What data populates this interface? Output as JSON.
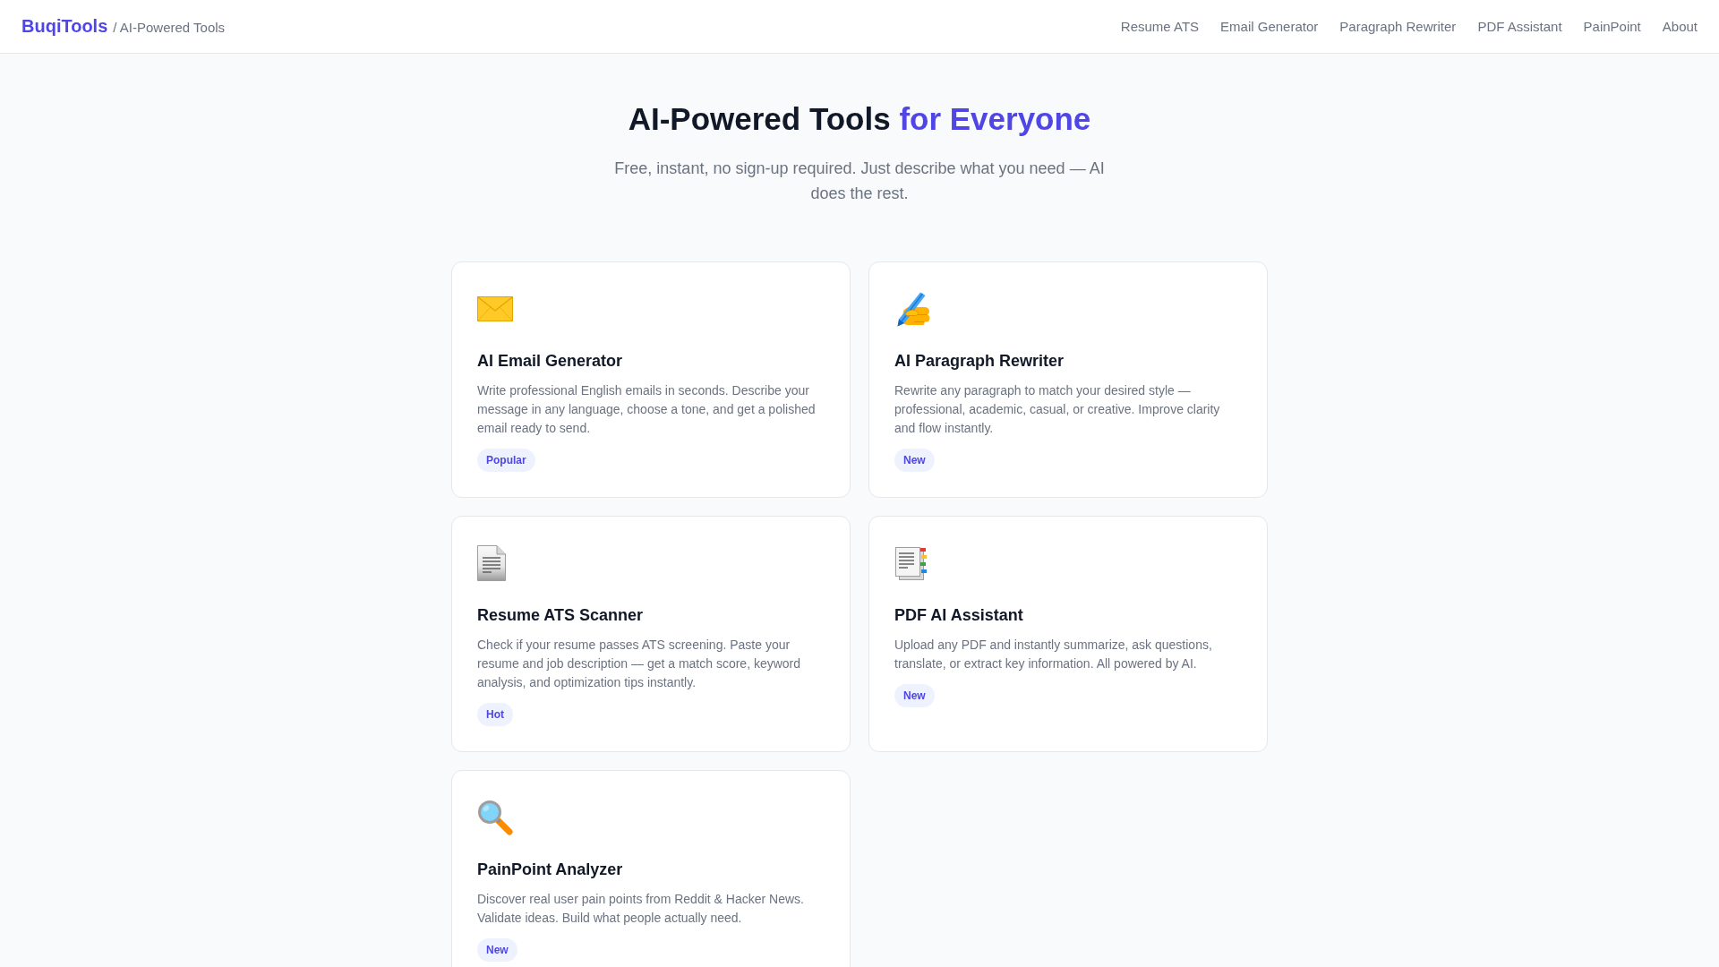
{
  "header": {
    "logo": "BuqiTools",
    "tagline": "/ AI-Powered Tools",
    "nav": [
      "Resume ATS",
      "Email Generator",
      "Paragraph Rewriter",
      "PDF Assistant",
      "PainPoint",
      "About"
    ]
  },
  "hero": {
    "title": "AI-Powered Tools",
    "title_highlight": "for Everyone",
    "subtitle": "Free, instant, no sign-up required. Just describe what you need — AI does the rest."
  },
  "tools": [
    {
      "name": "AI Email Generator",
      "description": "Write professional English emails in seconds. Describe your message in any language, choose a tone, and get a polished email ready to send.",
      "badge": "Popular"
    },
    {
      "name": "AI Paragraph Rewriter",
      "description": "Rewrite any paragraph to match your desired style — professional, academic, casual, or creative. Improve clarity and flow instantly.",
      "badge": "New"
    },
    {
      "name": "Resume ATS Scanner",
      "description": "Check if your resume passes ATS screening. Paste your resume and job description — get a match score, keyword analysis, and optimization tips instantly.",
      "badge": "Hot"
    },
    {
      "name": "PDF AI Assistant",
      "description": "Upload any PDF and instantly summarize, ask questions, translate, or extract key information. All powered by AI.",
      "badge": "New"
    },
    {
      "name": "PainPoint Analyzer",
      "description": "Discover real user pain points from Reddit & Hacker News. Validate ideas. Build what people actually need.",
      "badge": "New"
    }
  ]
}
